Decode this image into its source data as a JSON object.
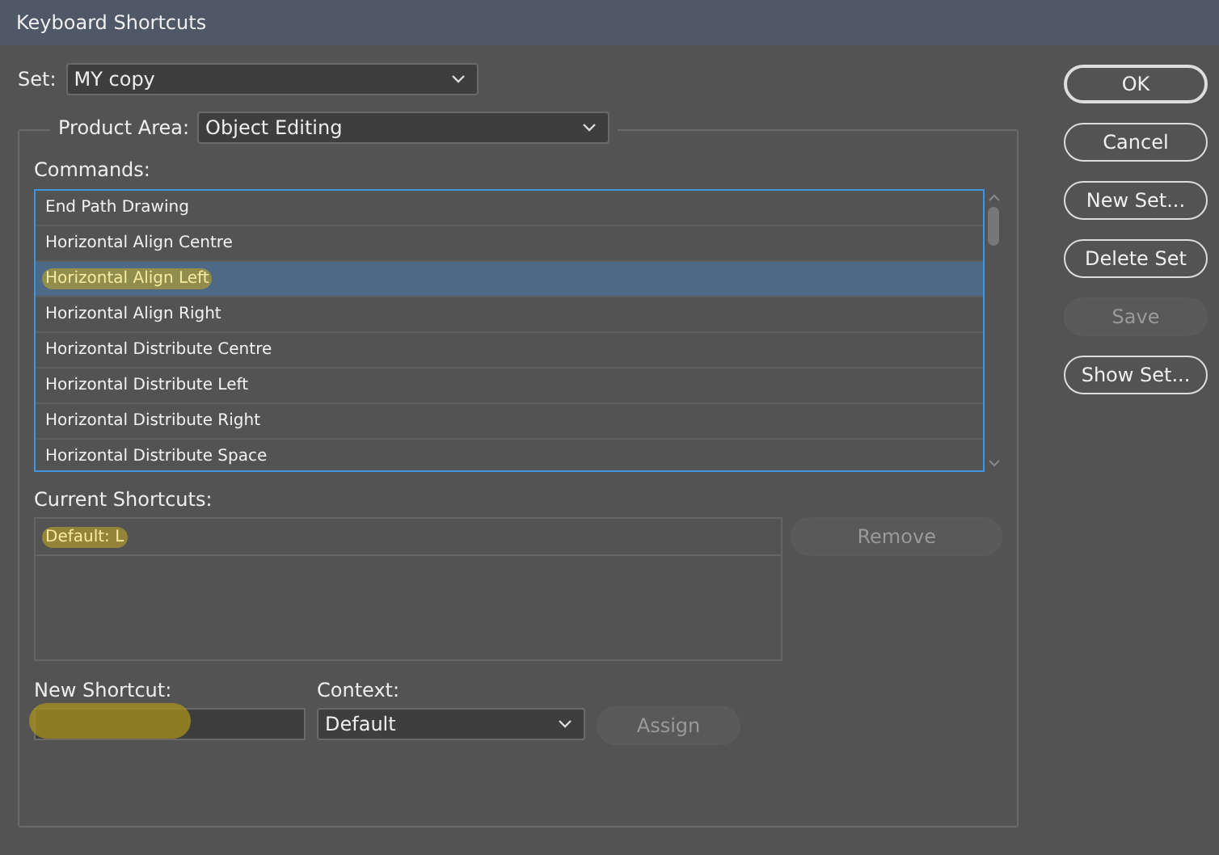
{
  "window": {
    "title": "Keyboard Shortcuts"
  },
  "set": {
    "label": "Set:",
    "value": "MY copy"
  },
  "product_area": {
    "label": "Product Area:",
    "value": "Object Editing"
  },
  "commands": {
    "label": "Commands:",
    "items": [
      {
        "text": "End Path Drawing",
        "selected": false,
        "highlighted": false
      },
      {
        "text": "Horizontal Align Centre",
        "selected": false,
        "highlighted": false
      },
      {
        "text": "Horizontal Align Left",
        "selected": true,
        "highlighted": true
      },
      {
        "text": "Horizontal Align Right",
        "selected": false,
        "highlighted": false
      },
      {
        "text": "Horizontal Distribute Centre",
        "selected": false,
        "highlighted": false
      },
      {
        "text": "Horizontal Distribute Left",
        "selected": false,
        "highlighted": false
      },
      {
        "text": "Horizontal Distribute Right",
        "selected": false,
        "highlighted": false
      },
      {
        "text": "Horizontal Distribute Space",
        "selected": false,
        "highlighted": false
      }
    ]
  },
  "current_shortcuts": {
    "label": "Current Shortcuts:",
    "items": [
      {
        "text": "Default: L",
        "highlighted": true
      }
    ],
    "remove": {
      "label": "Remove",
      "disabled": true
    }
  },
  "new_shortcut": {
    "label": "New Shortcut:",
    "highlighted": true
  },
  "context": {
    "label": "Context:",
    "value": "Default"
  },
  "assign": {
    "label": "Assign",
    "disabled": true
  },
  "buttons": [
    {
      "label": "OK",
      "disabled": false,
      "default": true
    },
    {
      "label": "Cancel",
      "disabled": false,
      "default": false
    },
    {
      "label": "New Set...",
      "disabled": false,
      "default": false
    },
    {
      "label": "Delete Set",
      "disabled": false,
      "default": false
    },
    {
      "label": "Save",
      "disabled": true,
      "default": false
    },
    {
      "label": "Show Set...",
      "disabled": false,
      "default": false
    }
  ]
}
